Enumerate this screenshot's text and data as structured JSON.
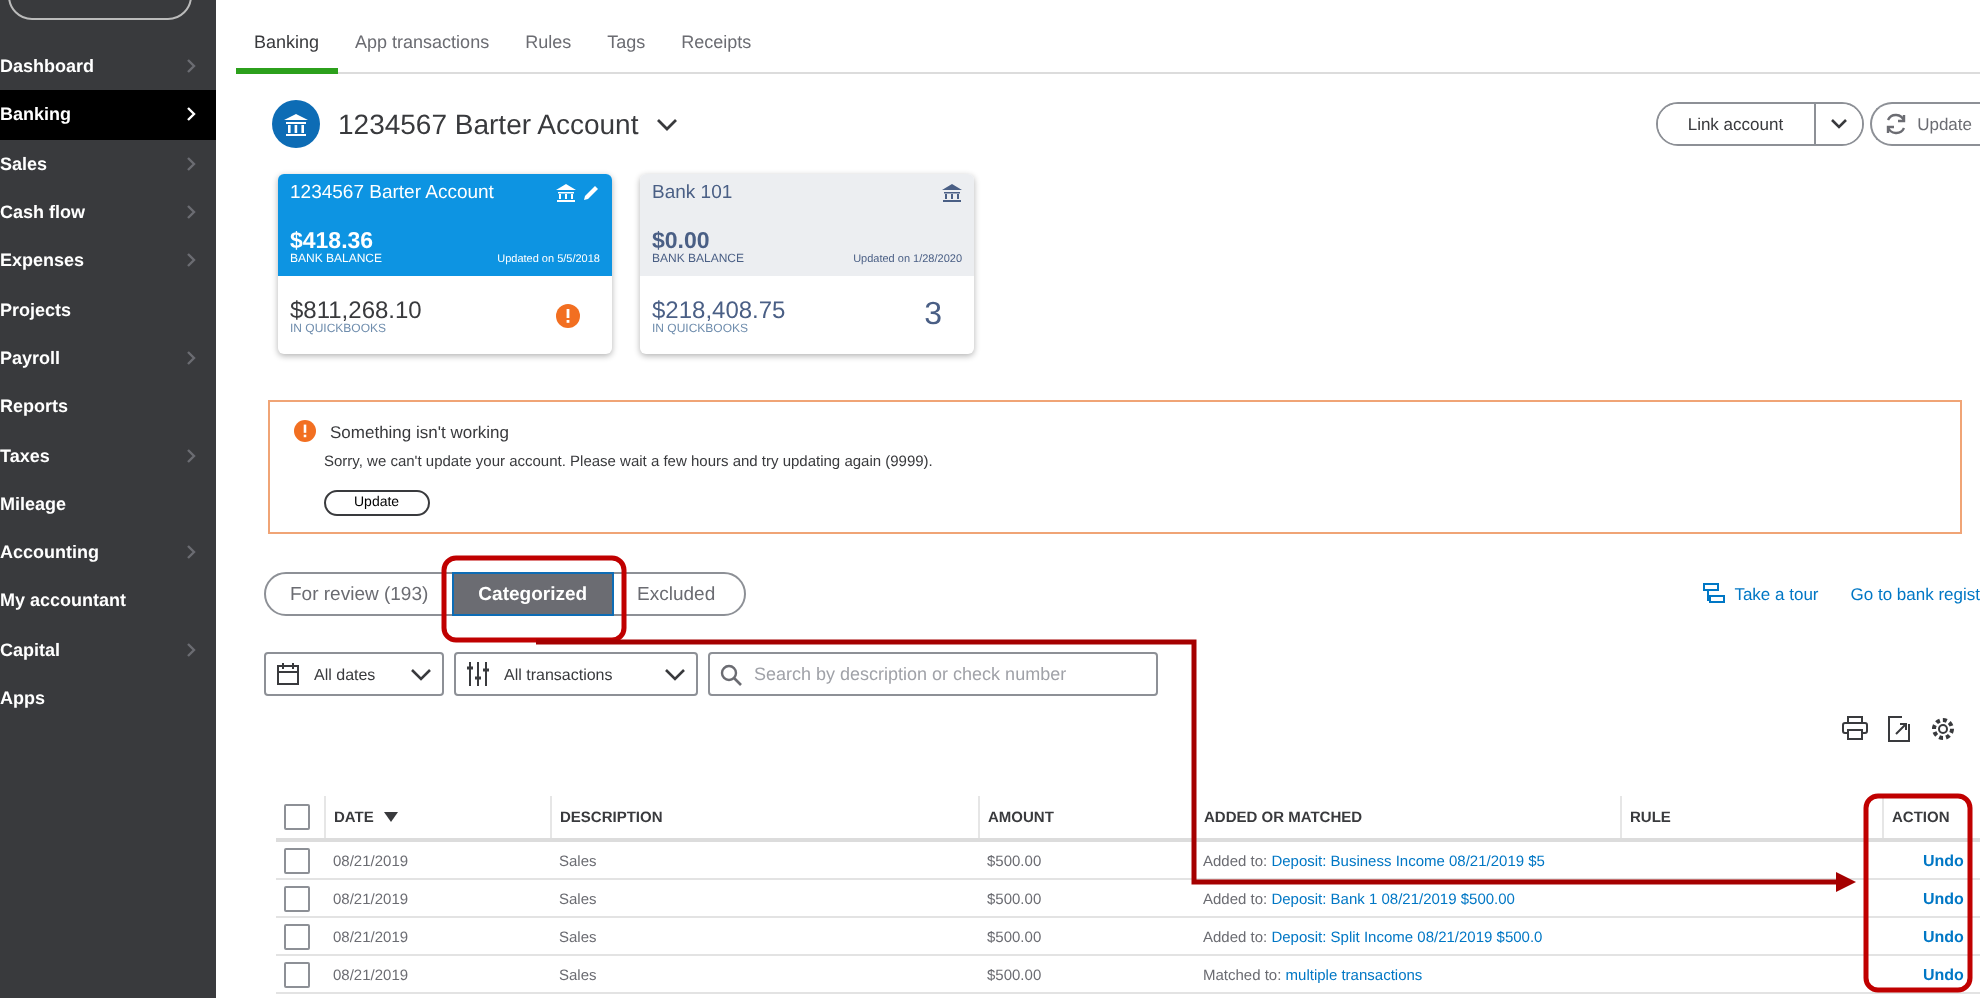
{
  "sidebar": {
    "items": [
      {
        "label": "Dashboard",
        "selected": false,
        "has_arrow": true
      },
      {
        "label": "Banking",
        "selected": true,
        "has_arrow": true
      },
      {
        "label": "Sales",
        "selected": false,
        "has_arrow": true
      },
      {
        "label": "Cash flow",
        "selected": false,
        "has_arrow": true
      },
      {
        "label": "Expenses",
        "selected": false,
        "has_arrow": true
      },
      {
        "label": "Projects",
        "selected": false,
        "has_arrow": false
      },
      {
        "label": "Payroll",
        "selected": false,
        "has_arrow": true
      },
      {
        "label": "Reports",
        "selected": false,
        "has_arrow": false
      },
      {
        "label": "Taxes",
        "selected": false,
        "has_arrow": true
      },
      {
        "label": "Mileage",
        "selected": false,
        "has_arrow": false
      },
      {
        "label": "Accounting",
        "selected": false,
        "has_arrow": true
      },
      {
        "label": "My accountant",
        "selected": false,
        "has_arrow": false
      },
      {
        "label": "Capital",
        "selected": false,
        "has_arrow": true
      },
      {
        "label": "Apps",
        "selected": false,
        "has_arrow": false
      }
    ]
  },
  "tabs": [
    {
      "label": "Banking",
      "selected": true
    },
    {
      "label": "App transactions",
      "selected": false
    },
    {
      "label": "Rules",
      "selected": false
    },
    {
      "label": "Tags",
      "selected": false
    },
    {
      "label": "Receipts",
      "selected": false
    }
  ],
  "account_header": {
    "title": "1234567 Barter Account",
    "link_account": "Link account",
    "update": "Update"
  },
  "account_cards": [
    {
      "name": "1234567 Barter Account",
      "selected": true,
      "editable": true,
      "bank_balance": "$418.36",
      "bank_balance_label": "BANK BALANCE",
      "updated": "Updated on 5/5/2018",
      "quickbooks_balance": "$811,268.10",
      "quickbooks_label": "IN QUICKBOOKS",
      "alert": true
    },
    {
      "name": "Bank 101",
      "selected": false,
      "editable": false,
      "bank_balance": "$0.00",
      "bank_balance_label": "BANK BALANCE",
      "updated": "Updated on 1/28/2020",
      "quickbooks_balance": "$218,408.75",
      "quickbooks_label": "IN QUICKBOOKS",
      "alert": false,
      "count": "3"
    }
  ],
  "error_banner": {
    "title": "Something isn't working",
    "message": "Sorry, we can't update your account. Please wait a few hours and try updating again (9999).",
    "button": "Update"
  },
  "view_tabs": [
    {
      "label": "For review (193)",
      "selected": false
    },
    {
      "label": "Categorized",
      "selected": true
    },
    {
      "label": "Excluded",
      "selected": false
    }
  ],
  "links": {
    "tour": "Take a tour",
    "register": "Go to bank regist"
  },
  "filters": {
    "dates": "All dates",
    "transactions": "All transactions",
    "search_placeholder": "Search by description or check number"
  },
  "table": {
    "all_checked": false,
    "columns": [
      "DATE",
      "DESCRIPTION",
      "AMOUNT",
      "ADDED OR MATCHED",
      "RULE",
      "ACTION"
    ],
    "rows": [
      {
        "checked": false,
        "date": "08/21/2019",
        "description": "Sales",
        "amount": "$500.00",
        "match_prefix": "Added to:",
        "match_link": "Deposit: Business Income 08/21/2019 $5",
        "action": "Undo"
      },
      {
        "checked": false,
        "date": "08/21/2019",
        "description": "Sales",
        "amount": "$500.00",
        "match_prefix": "Added to:",
        "match_link": "Deposit: Bank 1 08/21/2019 $500.00",
        "action": "Undo"
      },
      {
        "checked": false,
        "date": "08/21/2019",
        "description": "Sales",
        "amount": "$500.00",
        "match_prefix": "Added to:",
        "match_link": "Deposit: Split Income 08/21/2019 $500.0",
        "action": "Undo"
      },
      {
        "checked": false,
        "date": "08/21/2019",
        "description": "Sales",
        "amount": "$500.00",
        "match_prefix": "Matched to:",
        "match_link": "multiple transactions",
        "action": "Undo"
      }
    ]
  }
}
